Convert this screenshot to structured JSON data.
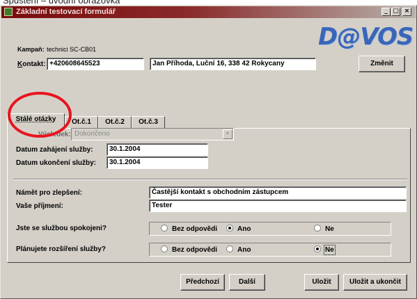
{
  "caption": "Spuštění – úvodní obrazovka",
  "window": {
    "title": "Základní testovací formulář",
    "controls": [
      "_",
      "□",
      "×"
    ]
  },
  "logo": "D@VOS",
  "header": {
    "campaign_label": "Kampaň:",
    "campaign_value": "technici SC-CB01",
    "contact_label": "Kontakt:",
    "contact_phone": "+420608645523",
    "contact_name": "Jan Příhoda, Luční 16, 338 42 Rokycany",
    "change_button": "Změnit"
  },
  "tabs": [
    {
      "label": "Stálé otázky",
      "active": true
    },
    {
      "label": "Ot.č.1",
      "active": false
    },
    {
      "label": "Ot.č.2",
      "active": false
    },
    {
      "label": "Ot.č.3",
      "active": false
    }
  ],
  "form": {
    "result_label": "Výsledek:",
    "result_value": "Dokončeno",
    "start_label": "Datum zahájení služby:",
    "start_value": "30.1.2004",
    "end_label": "Datum ukončení služby:",
    "end_value": "30.1.2004",
    "improve_label": "Námět pro zlepšení:",
    "improve_value": "Častější kontakt s obchodním zástupcem",
    "surname_label": "Vaše příjmení:",
    "surname_value": "Tester",
    "q1": {
      "label": "Jste se službou spokojeni?",
      "options": [
        "Bez odpovědi",
        "Ano",
        "Ne"
      ],
      "selected": "Ano"
    },
    "q2": {
      "label": "Plánujete rozšíření služby?",
      "options": [
        "Bez odpovědi",
        "Ano",
        "Ne"
      ],
      "selected": "Ne"
    }
  },
  "footer": {
    "prev": "Předchozí",
    "next": "Další",
    "save": "Uložit",
    "save_finish": "Uložit a ukončit"
  },
  "colors": {
    "highlight_circle": "#e8141e",
    "title_bar": "#7a0a0a",
    "logo": "#3a66b8"
  }
}
